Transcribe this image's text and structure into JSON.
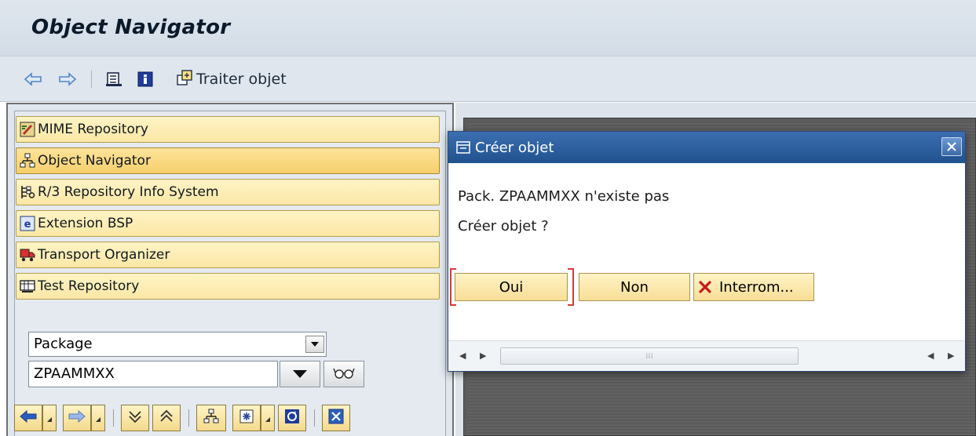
{
  "window": {
    "title": "Object Navigator"
  },
  "toolbar": {
    "edit_object_label": "Traiter objet"
  },
  "nav": {
    "items": [
      {
        "label": "MIME Repository",
        "icon": "mime-repository-icon"
      },
      {
        "label": "Object Navigator",
        "icon": "hierarchy-icon",
        "active": true
      },
      {
        "label": "R/3 Repository Info System",
        "icon": "info-system-icon"
      },
      {
        "label": "Extension BSP",
        "icon": "bsp-icon"
      },
      {
        "label": "Transport Organizer",
        "icon": "truck-icon"
      },
      {
        "label": "Test Repository",
        "icon": "test-icon"
      }
    ]
  },
  "browser": {
    "object_type_selected": "Package",
    "object_name_value": "ZPAAMMXX"
  },
  "dialog": {
    "title": "Créer objet",
    "message_line1": "Pack. ZPAAMMXX n'existe pas",
    "message_line2": "Créer objet ?",
    "buttons": {
      "yes": "Oui",
      "no": "Non",
      "cancel": "Interrom..."
    }
  },
  "colors": {
    "titlebar_bg": "#dfe6ee",
    "button_yellow": "#fbe7a6",
    "dialog_header": "#2a5b98",
    "focus_red": "#d43a3a"
  }
}
